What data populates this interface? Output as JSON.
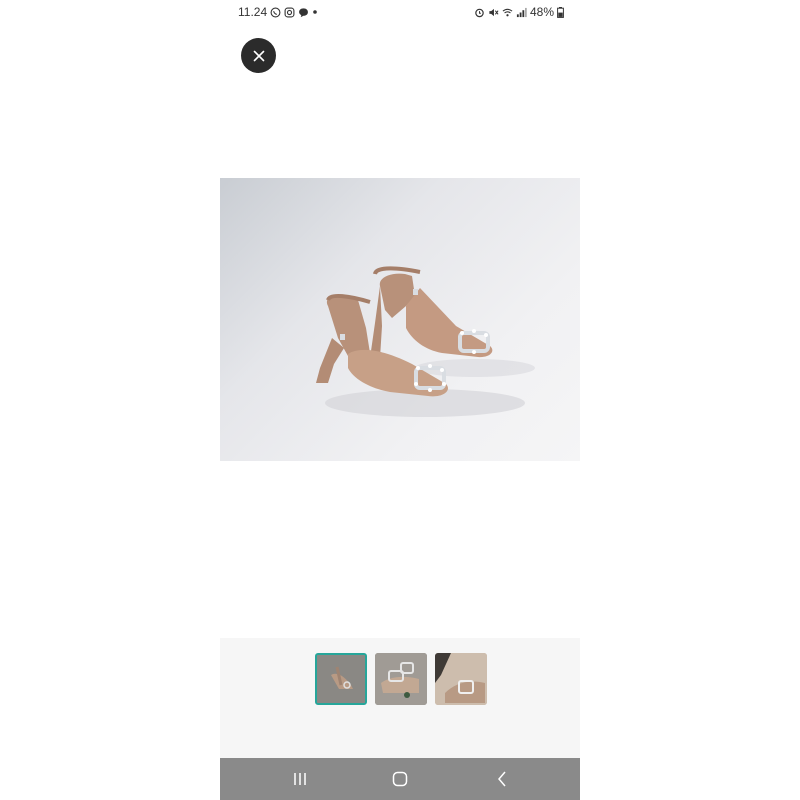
{
  "status_bar": {
    "time": "11.24",
    "battery": "48%",
    "left_icons": [
      "whatsapp-icon",
      "instagram-icon",
      "message-icon",
      "dot-icon"
    ],
    "right_icons": [
      "alarm-icon",
      "mute-icon",
      "wifi-icon",
      "signal-icon",
      "battery-icon"
    ]
  },
  "viewer": {
    "close_icon": "close-icon",
    "main_image": "product-photo-nude-pointed-heels-with-crystal-buckle",
    "thumbnails": [
      {
        "name": "thumbnail-1",
        "selected": true
      },
      {
        "name": "thumbnail-2",
        "selected": false
      },
      {
        "name": "thumbnail-3",
        "selected": false
      }
    ],
    "accent_color": "#26a69a"
  },
  "nav_bar": {
    "buttons": [
      "recents-icon",
      "home-icon",
      "back-icon"
    ],
    "background": "#8a8a8a"
  }
}
